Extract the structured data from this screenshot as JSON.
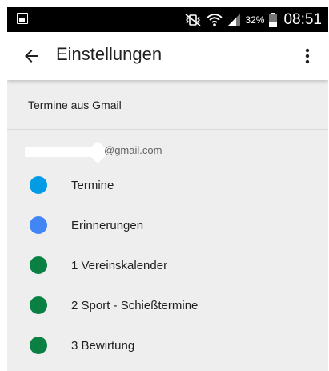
{
  "status_bar": {
    "battery_percent": "32%",
    "time": "08:51",
    "icons": [
      "photo-notification-icon",
      "mute-vibrate-icon",
      "wifi-icon",
      "signal-icon",
      "battery-icon"
    ]
  },
  "app_bar": {
    "title": "Einstellungen",
    "back_icon": "arrow-back-icon",
    "menu_icon": "more-vert-icon"
  },
  "settings": {
    "section_header": "Termine aus Gmail",
    "account_email": "@gmail.com",
    "calendars": [
      {
        "label": "Termine",
        "color": "#039be5"
      },
      {
        "label": "Erinnerungen",
        "color": "#4285f4"
      },
      {
        "label": "1 Vereinskalender",
        "color": "#0b8043"
      },
      {
        "label": "2 Sport - Schießtermine",
        "color": "#0b8043"
      },
      {
        "label": "3 Bewirtung",
        "color": "#0b8043"
      }
    ]
  }
}
